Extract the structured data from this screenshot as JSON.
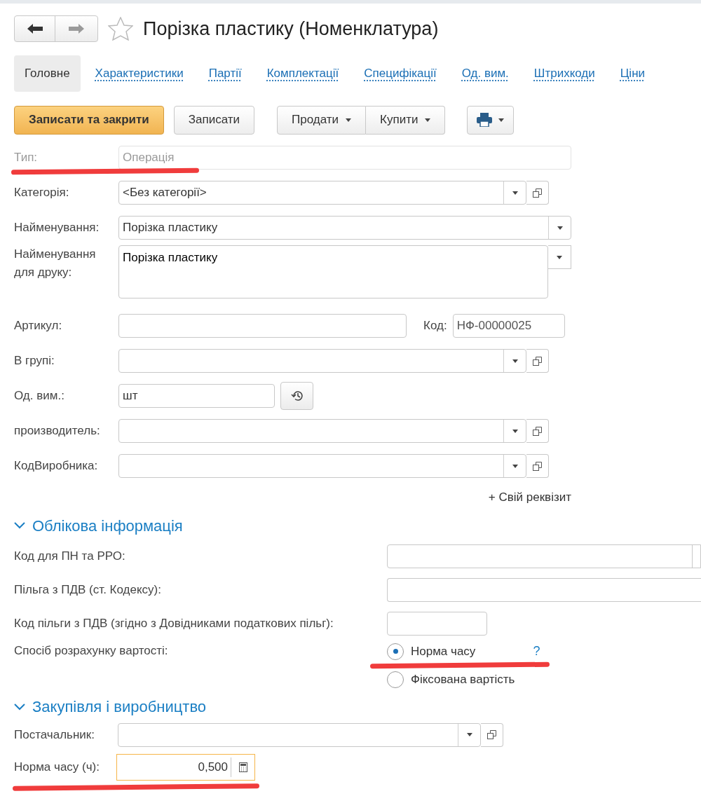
{
  "title": "Порізка пластику (Номенклатура)",
  "tabs": [
    {
      "label": "Головне",
      "selected": true
    },
    {
      "label": "Характеристики",
      "selected": false
    },
    {
      "label": "Партії",
      "selected": false
    },
    {
      "label": "Комплектації",
      "selected": false
    },
    {
      "label": "Специфікації",
      "selected": false
    },
    {
      "label": "Од. вим.",
      "selected": false
    },
    {
      "label": "Штрихкоди",
      "selected": false
    },
    {
      "label": "Ціни",
      "selected": false
    }
  ],
  "toolbar": [
    {
      "label": "Записати та закрити",
      "kind": "primary"
    },
    {
      "label": "Записати",
      "kind": "plain"
    },
    {
      "label": "Продати",
      "kind": "split_left"
    },
    {
      "label": "Купити",
      "kind": "split_right"
    },
    {
      "kind": "print"
    }
  ],
  "fields": [
    {
      "label": "Тип:",
      "value": "Операція",
      "kind": "readonly",
      "highlighted": true
    },
    {
      "label": "Категорія:",
      "value": "<Без категорії>",
      "kind": "select_open"
    },
    {
      "label": "Найменування:",
      "value": "Порізка пластику",
      "kind": "select"
    },
    {
      "label": "Найменування для друку:",
      "value": "Порізка пластику",
      "kind": "multiline"
    },
    {
      "label": "Артикул:",
      "kind": "article",
      "code_label": "Код:",
      "code_value": "НФ-00000025"
    },
    {
      "label": "В групі:",
      "kind": "select_open"
    },
    {
      "label": "Од. вим.:",
      "value": "шт",
      "kind": "unit"
    },
    {
      "label": "производитель:",
      "kind": "select_open"
    },
    {
      "label": "КодВиробника:",
      "kind": "select_open"
    }
  ],
  "add_attribute_link": "+ Свій реквізит",
  "accounting": {
    "title": "Облікова інформація",
    "expanded": true,
    "fields": [
      {
        "label": "Код для ПН та РРО:",
        "kind": "wide_select"
      },
      {
        "label": "Пільга з ПДВ (ст. Кодексу):",
        "kind": "wide"
      },
      {
        "label": "Код пільги з ПДВ (згідно з Довідниками податкових пільг):",
        "kind": "short"
      }
    ],
    "cost_method": {
      "label": "Спосіб розрахунку вартості:",
      "help": "?",
      "options": [
        {
          "label": "Норма часу",
          "selected": true,
          "highlighted": true
        },
        {
          "label": "Фіксована вартість",
          "selected": false,
          "highlighted": false
        }
      ]
    }
  },
  "purchase": {
    "title": "Закупівля і виробництво",
    "expanded": true,
    "fields": [
      {
        "label": "Постачальник:",
        "kind": "select_open"
      },
      {
        "label": "Норма часу (ч):",
        "value": "0,500",
        "kind": "number",
        "focused": true,
        "highlighted": true
      }
    ]
  }
}
